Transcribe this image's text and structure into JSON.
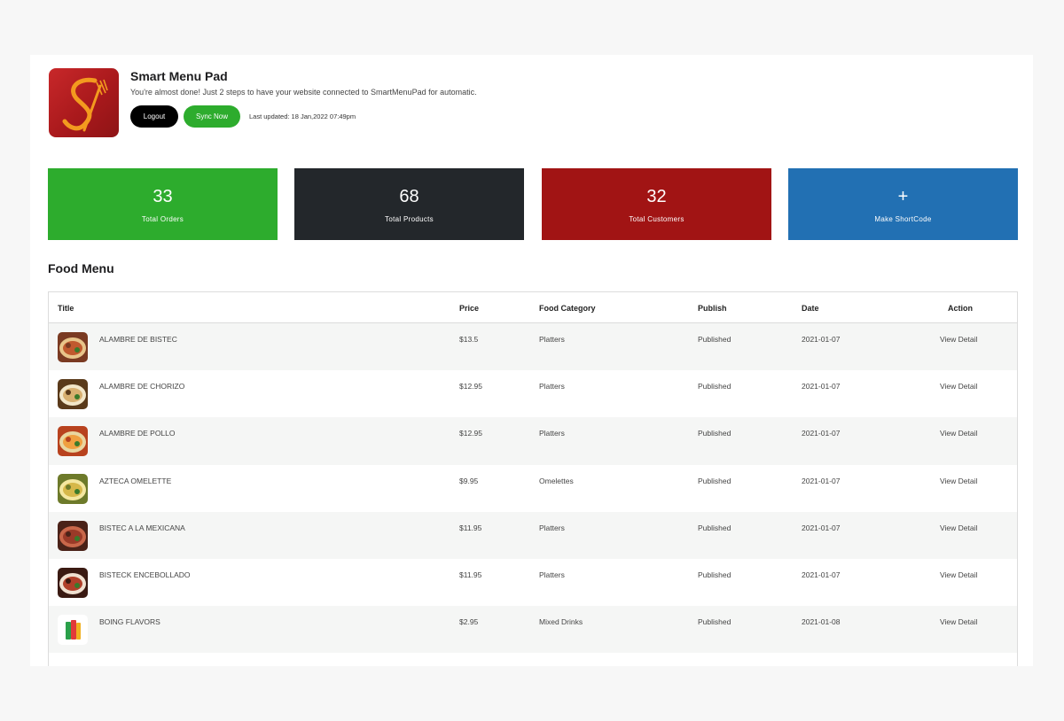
{
  "header": {
    "title": "Smart Menu Pad",
    "subtitle": "You're almost done! Just 2 steps to have your website connected to SmartMenuPad for automatic.",
    "logout_label": "Logout",
    "sync_label": "Sync Now",
    "last_updated": "Last updated: 18 Jan,2022 07:49pm",
    "logo_colors": {
      "background": "#b01f22",
      "mark": "#f39a1f"
    }
  },
  "stats": [
    {
      "value": "33",
      "label": "Total Orders",
      "color": "#2dac2d"
    },
    {
      "value": "68",
      "label": "Total Products",
      "color": "#23272b"
    },
    {
      "value": "32",
      "label": "Total Customers",
      "color": "#a11414"
    },
    {
      "value": "+",
      "label": "Make ShortCode",
      "color": "#2270b3"
    }
  ],
  "section_title": "Food Menu",
  "table": {
    "columns": [
      "Title",
      "Price",
      "Food Category",
      "Publish",
      "Date",
      "Action"
    ],
    "rows": [
      {
        "title": "ALAMBRE DE BISTEC",
        "price": "$13.5",
        "category": "Platters",
        "publish": "Published",
        "date": "2021-01-07",
        "action": "View Detail",
        "thumb": "food-photo-icon"
      },
      {
        "title": "ALAMBRE DE CHORIZO",
        "price": "$12.95",
        "category": "Platters",
        "publish": "Published",
        "date": "2021-01-07",
        "action": "View Detail",
        "thumb": "food-photo-icon"
      },
      {
        "title": "ALAMBRE DE POLLO",
        "price": "$12.95",
        "category": "Platters",
        "publish": "Published",
        "date": "2021-01-07",
        "action": "View Detail",
        "thumb": "food-photo-icon"
      },
      {
        "title": "AZTECA OMELETTE",
        "price": "$9.95",
        "category": "Omelettes",
        "publish": "Published",
        "date": "2021-01-07",
        "action": "View Detail",
        "thumb": "food-photo-icon"
      },
      {
        "title": "BISTEC A LA MEXICANA",
        "price": "$11.95",
        "category": "Platters",
        "publish": "Published",
        "date": "2021-01-07",
        "action": "View Detail",
        "thumb": "food-photo-icon"
      },
      {
        "title": "BISTECK ENCEBOLLADO",
        "price": "$11.95",
        "category": "Platters",
        "publish": "Published",
        "date": "2021-01-07",
        "action": "View Detail",
        "thumb": "food-photo-icon"
      },
      {
        "title": "BOING FLAVORS",
        "price": "$2.95",
        "category": "Mixed Drinks",
        "publish": "Published",
        "date": "2021-01-08",
        "action": "View Detail",
        "thumb": "drink-bottles-icon"
      }
    ]
  }
}
